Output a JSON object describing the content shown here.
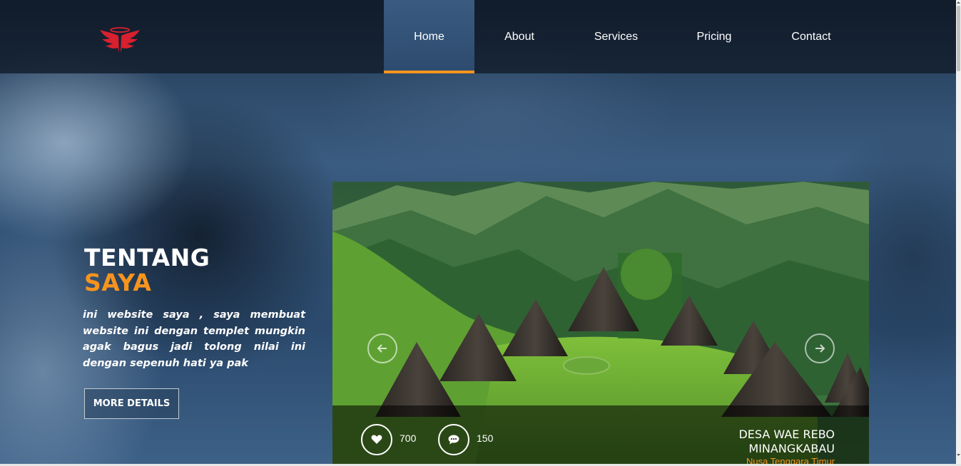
{
  "nav": {
    "items": [
      {
        "label": "Home",
        "active": true
      },
      {
        "label": "About",
        "active": false
      },
      {
        "label": "Services",
        "active": false
      },
      {
        "label": "Pricing",
        "active": false
      },
      {
        "label": "Contact",
        "active": false
      }
    ]
  },
  "hero": {
    "title_line1": "TENTANG",
    "title_line2": "SAYA",
    "description": "ini website saya , saya membuat website ini dengan templet mungkin agak bagus jadi tolong nilai ini dengan sepenuh hati ya pak",
    "button_label": "MORE DETAILS"
  },
  "slide": {
    "likes": "700",
    "comments": "150",
    "title_line1": "DESA WAE REBO",
    "title_line2": "MINANGKABAU",
    "subtitle": "Nusa Tenggara Timur"
  },
  "icons": {
    "logo": "winged-logo-icon",
    "prev": "arrow-left-icon",
    "next": "arrow-right-icon",
    "likes": "heart-icon",
    "comments": "comment-icon"
  },
  "colors": {
    "accent": "#f7941d",
    "logo_red": "#d8202e",
    "header_bg": "#141f2e"
  }
}
